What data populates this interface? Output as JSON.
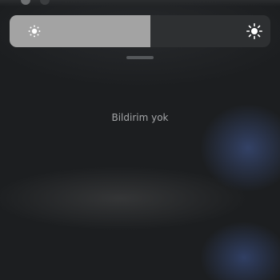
{
  "brightness": {
    "level": 0.54,
    "low_icon": "brightness-low-icon",
    "high_icon": "brightness-high-icon",
    "fill_color": "#a3a3a3",
    "track_color": "#2e3032"
  },
  "notifications": {
    "empty_text": "Bildirim yok"
  }
}
